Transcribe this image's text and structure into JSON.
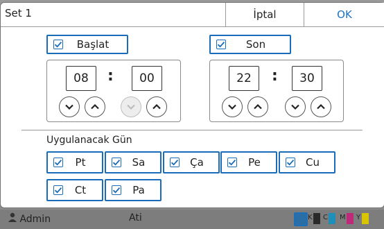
{
  "dialog": {
    "title": "Set 1",
    "cancel_label": "İptal",
    "ok_label": "OK"
  },
  "start": {
    "label": "Başlat",
    "checked": true,
    "hour": "08",
    "minute": "00",
    "separator": ":"
  },
  "end": {
    "label": "Son",
    "checked": true,
    "hour": "22",
    "minute": "30",
    "separator": ":"
  },
  "days": {
    "section_label": "Uygulanacak Gün",
    "items": [
      {
        "label": "Pt",
        "checked": true
      },
      {
        "label": "Sa",
        "checked": true
      },
      {
        "label": "Ça",
        "checked": true
      },
      {
        "label": "Pe",
        "checked": true
      },
      {
        "label": "Cu",
        "checked": true
      },
      {
        "label": "Ct",
        "checked": true
      },
      {
        "label": "Pa",
        "checked": true
      }
    ]
  },
  "background": {
    "user_name": "Admin",
    "second_label": "Ati",
    "ink_colors": [
      {
        "label": "K",
        "color": "#2a2a2a"
      },
      {
        "label": "C",
        "color": "#1e8fb8"
      },
      {
        "label": "M",
        "color": "#c0287a"
      },
      {
        "label": "Y",
        "color": "#d8c400"
      }
    ]
  },
  "colors": {
    "accent": "#1a6bb8",
    "ok_text": "#1a73c8",
    "overlay": "#8c8c8c"
  }
}
